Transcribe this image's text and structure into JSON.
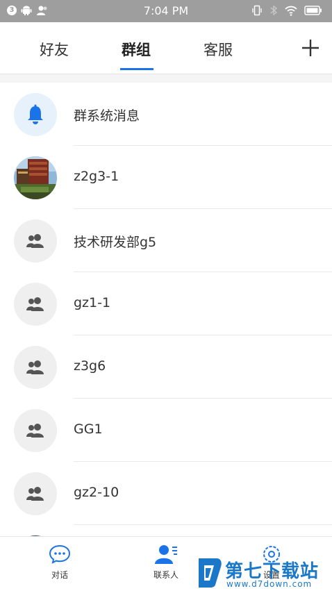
{
  "status_bar": {
    "time": "7:04 PM",
    "notification_count": "3"
  },
  "tabs": [
    {
      "label": "好友",
      "active": false
    },
    {
      "label": "群组",
      "active": true
    },
    {
      "label": "客服",
      "active": false
    }
  ],
  "groups": [
    {
      "name": "群系统消息",
      "avatar": "bell-icon"
    },
    {
      "name": "z2g3-1",
      "avatar": "photo"
    },
    {
      "name": "技术研发部g5",
      "avatar": "group-icon"
    },
    {
      "name": "gz1-1",
      "avatar": "group-icon"
    },
    {
      "name": "z3g6",
      "avatar": "group-icon"
    },
    {
      "name": "GG1",
      "avatar": "group-icon"
    },
    {
      "name": "gz2-10",
      "avatar": "group-icon"
    }
  ],
  "bottom_nav": [
    {
      "label": "对话",
      "icon": "chat-icon"
    },
    {
      "label": "联系人",
      "icon": "contacts-icon",
      "active": true
    },
    {
      "label": "设置",
      "icon": "settings-icon"
    }
  ],
  "watermark": {
    "title": "第七下载站",
    "url": "www.d7down.com"
  },
  "colors": {
    "accent": "#1a73e8",
    "status_bar": "#9e9e9e",
    "watermark": "#1b78c9"
  }
}
